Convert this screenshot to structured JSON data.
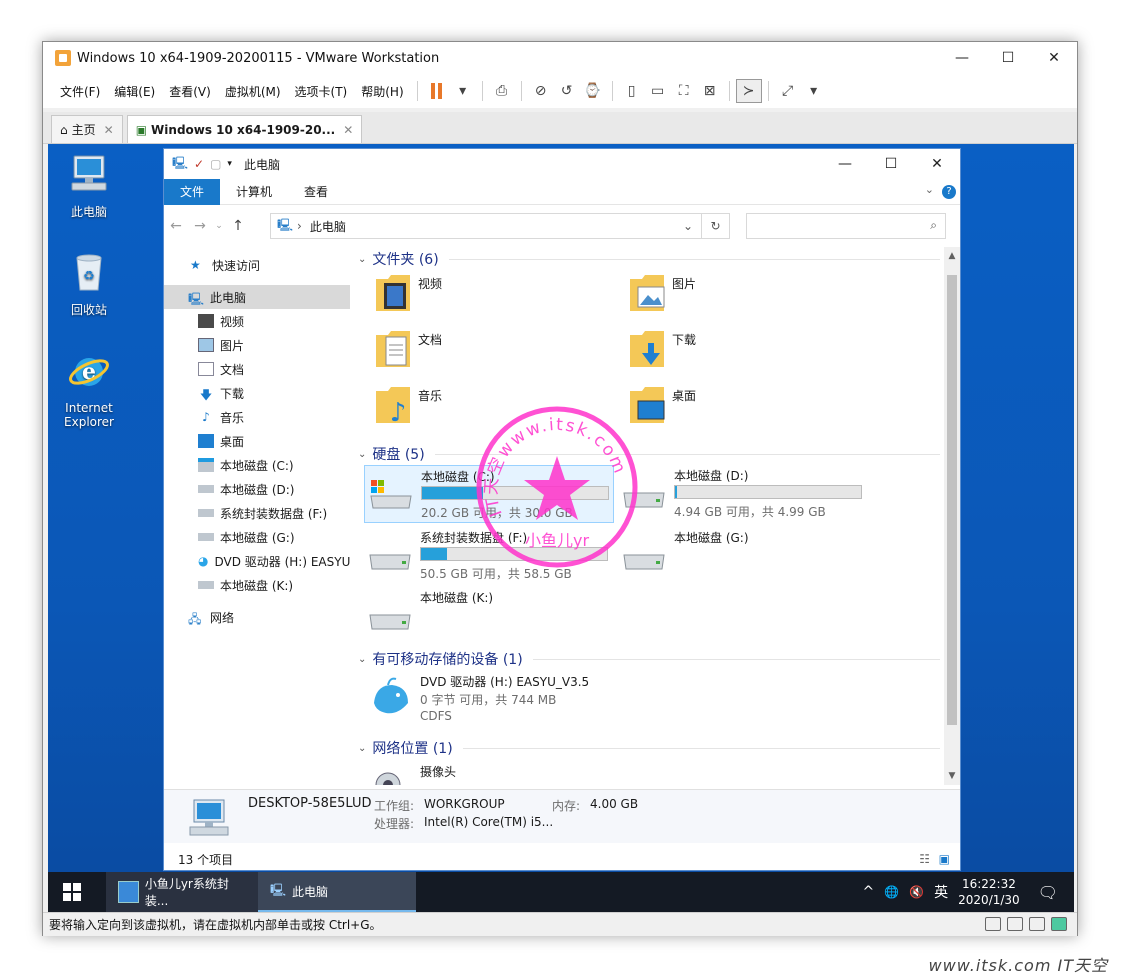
{
  "vm": {
    "title": "Windows 10 x64-1909-20200115 - VMware Workstation",
    "menu": [
      "文件(F)",
      "编辑(E)",
      "查看(V)",
      "虚拟机(M)",
      "选项卡(T)",
      "帮助(H)"
    ],
    "tabs": [
      {
        "label": "主页"
      },
      {
        "label": "Windows 10 x64-1909-20..."
      }
    ],
    "status_text": "要将输入定向到该虚拟机，请在虚拟机内部单击或按 Ctrl+G。"
  },
  "desktop": {
    "icons": [
      {
        "label": "此电脑"
      },
      {
        "label": "回收站"
      },
      {
        "label": "Internet Explorer"
      }
    ]
  },
  "explorer": {
    "title": "此电脑",
    "ribbon": [
      "文件",
      "计算机",
      "查看"
    ],
    "address": "此电脑",
    "nav": {
      "quick_access": "快速访问",
      "this_pc": "此电脑",
      "items": [
        "视频",
        "图片",
        "文档",
        "下载",
        "音乐",
        "桌面",
        "本地磁盘 (C:)",
        "本地磁盘 (D:)",
        "系统封装数据盘 (F:)",
        "本地磁盘 (G:)",
        "DVD 驱动器 (H:) EASYU",
        "本地磁盘 (K:)"
      ],
      "network": "网络"
    },
    "groups": {
      "folders": "文件夹 (6)",
      "drives": "硬盘 (5)",
      "removable": "有可移动存储的设备 (1)",
      "network": "网络位置 (1)"
    },
    "folders": [
      "视频",
      "图片",
      "文档",
      "下载",
      "音乐",
      "桌面"
    ],
    "drives": [
      {
        "name": "本地磁盘 (C:)",
        "free": "20.2 GB 可用，共 30.0 GB",
        "used_fraction": 0.33
      },
      {
        "name": "本地磁盘 (D:)",
        "free": "4.94 GB 可用，共 4.99 GB",
        "used_fraction": 0.01
      },
      {
        "name": "系统封装数据盘 (F:)",
        "free": "50.5 GB 可用，共 58.5 GB",
        "used_fraction": 0.14
      },
      {
        "name": "本地磁盘 (G:)"
      },
      {
        "name": "本地磁盘 (K:)"
      }
    ],
    "dvd": {
      "name": "DVD 驱动器 (H:) EASYU_V3.5",
      "free": "0 字节 可用，共 744 MB",
      "fs": "CDFS"
    },
    "network_item": "摄像头",
    "details": {
      "computer": "DESKTOP-58E5LUD",
      "workgroup_label": "工作组:",
      "workgroup": "WORKGROUP",
      "memory_label": "内存:",
      "memory": "4.00 GB",
      "cpu_label": "处理器:",
      "cpu": "Intel(R) Core(TM) i5..."
    },
    "status": "13 个项目"
  },
  "taskbar": {
    "apps": [
      "小鱼儿yr系统封装...",
      "此电脑"
    ],
    "ime": "英",
    "time": "16:22:32",
    "date": "2020/1/30"
  },
  "watermark": {
    "arc_text": "IT天空www.itsk.com",
    "inner_text": "小鱼儿yr"
  },
  "site_mark": "www.itsk.com IT天空",
  "colors": {
    "accent": "#1979ca",
    "desktop": "#0a5fc4",
    "drive_bar": "#26a0da",
    "watermark": "#ff33cc",
    "pause": "#e8782a"
  }
}
